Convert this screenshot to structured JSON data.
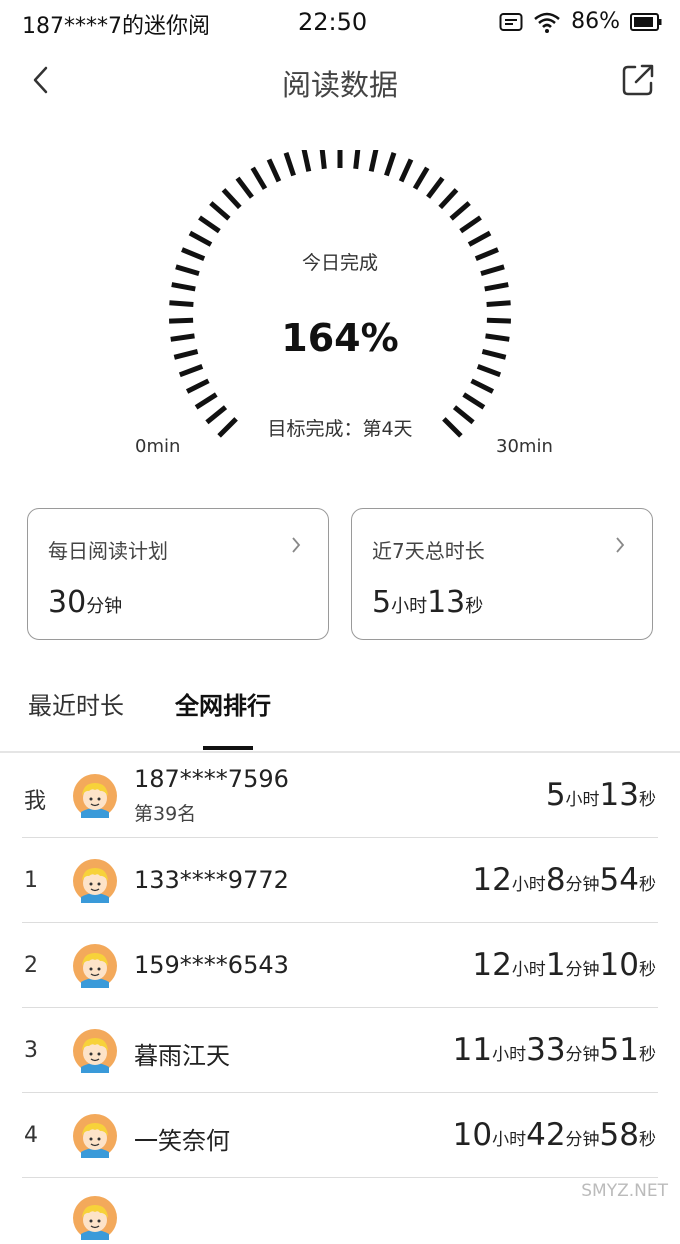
{
  "status_bar": {
    "carrier": "187****7的迷你阅",
    "time": "22:50",
    "battery": "86%"
  },
  "nav": {
    "title": "阅读数据",
    "back_icon": "chevron-left-icon",
    "share_icon": "share-icon"
  },
  "gauge": {
    "title": "今日完成",
    "value": "164%",
    "target": "目标完成：第4天",
    "min_label": "0min",
    "max_label": "30min"
  },
  "cards": {
    "plan": {
      "title": "每日阅读计划",
      "value": "30",
      "unit": "分钟"
    },
    "week": {
      "title": "近7天总时长",
      "hours": "5",
      "hours_unit": "小时",
      "seconds": "13",
      "seconds_unit": "秒"
    }
  },
  "tabs": {
    "recent": "最近时长",
    "ranking": "全网排行"
  },
  "ranking": {
    "me": {
      "rank": "我",
      "name": "187****7596",
      "sub": "第39名",
      "d": [
        {
          "n": "5",
          "u": "小时"
        },
        {
          "n": "13",
          "u": "秒"
        }
      ]
    },
    "rows": [
      {
        "rank": "1",
        "name": "133****9772",
        "d": [
          {
            "n": "12",
            "u": "小时"
          },
          {
            "n": "8",
            "u": "分钟"
          },
          {
            "n": "54",
            "u": "秒"
          }
        ]
      },
      {
        "rank": "2",
        "name": "159****6543",
        "d": [
          {
            "n": "12",
            "u": "小时"
          },
          {
            "n": "1",
            "u": "分钟"
          },
          {
            "n": "10",
            "u": "秒"
          }
        ]
      },
      {
        "rank": "3",
        "name": "暮雨江天",
        "d": [
          {
            "n": "11",
            "u": "小时"
          },
          {
            "n": "33",
            "u": "分钟"
          },
          {
            "n": "51",
            "u": "秒"
          }
        ]
      },
      {
        "rank": "4",
        "name": "一笑奈何",
        "d": [
          {
            "n": "10",
            "u": "小时"
          },
          {
            "n": "42",
            "u": "分钟"
          },
          {
            "n": "58",
            "u": "秒"
          }
        ]
      }
    ]
  },
  "watermark": "SMYZ.NET"
}
